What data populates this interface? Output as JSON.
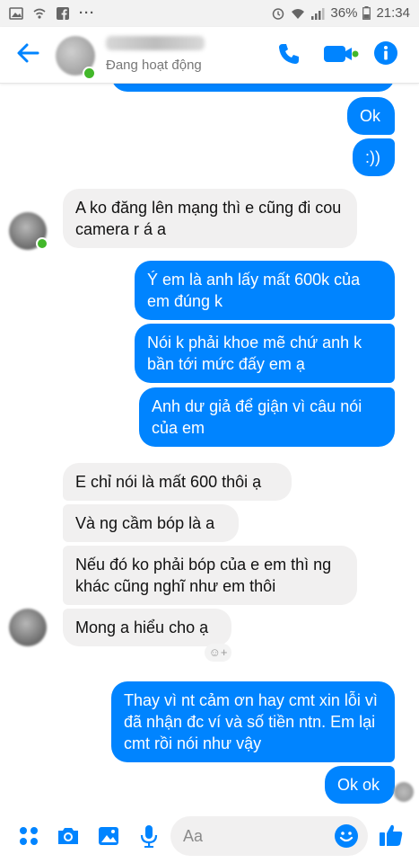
{
  "status_bar": {
    "battery": "36%",
    "time": "21:34",
    "overflow": "···"
  },
  "header": {
    "status": "Đang hoạt động",
    "accent": "#0084ff",
    "online_color": "#42b72a"
  },
  "messages": [
    {
      "side": "out",
      "text": "Ok"
    },
    {
      "side": "out",
      "text": ":))"
    },
    {
      "side": "in",
      "text": "A ko đăng lên mạng thì e cũng đi cou camera r á a"
    },
    {
      "side": "out",
      "text": "Ý em là anh lấy mất 600k của em đúng k"
    },
    {
      "side": "out",
      "text": "Nói k phải khoe mẽ chứ anh k bần tới mức đấy em ạ"
    },
    {
      "side": "out",
      "text": "Anh dư giả để giận vì câu nói của em"
    },
    {
      "side": "in",
      "text": "E chỉ nói là mất 600 thôi ạ"
    },
    {
      "side": "in",
      "text": "Và ng cầm bóp là a"
    },
    {
      "side": "in",
      "text": "Nếu đó ko phải bóp của e em thì ng khác cũng nghĩ như em thôi"
    },
    {
      "side": "in",
      "text": "Mong a hiểu cho ạ"
    },
    {
      "side": "out",
      "text": "Thay vì nt cảm ơn hay cmt xin lỗi vì đã nhận đc ví và số tiền ntn. Em lại cmt rồi nói như vậy"
    },
    {
      "side": "out",
      "text": "Ok ok"
    }
  ],
  "reaction": "☺+",
  "composer": {
    "placeholder": "Aa"
  },
  "icons": {
    "back": "arrow-left-icon",
    "phone": "phone-icon",
    "video": "video-camera-icon",
    "info": "info-icon",
    "more": "grid-dots-icon",
    "camera": "camera-icon",
    "gallery": "image-icon",
    "mic": "microphone-icon",
    "emoji": "emoji-icon",
    "like": "thumbs-up-icon"
  }
}
